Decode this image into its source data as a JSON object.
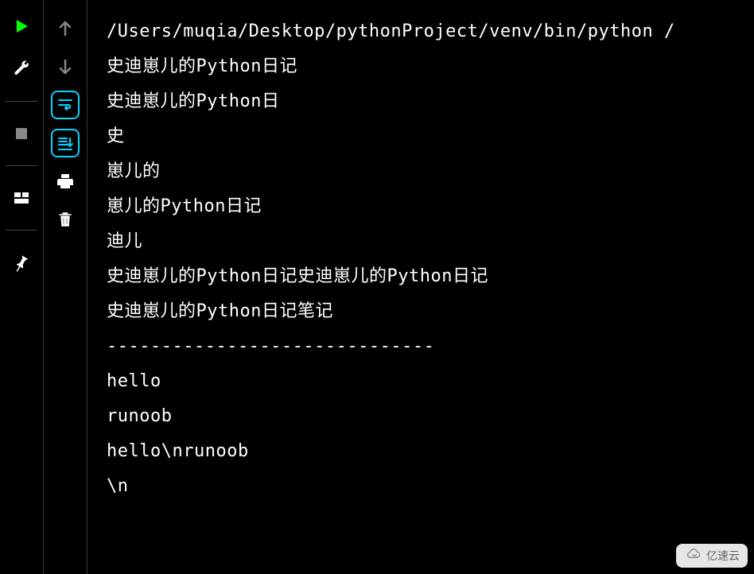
{
  "toolbar_left": {
    "run": "run-icon",
    "debug": "wrench-icon",
    "stop": "stop-icon",
    "layout": "layout-icon",
    "pin": "pin-icon"
  },
  "toolbar_actions": {
    "up": "arrow-up-icon",
    "down": "arrow-down-icon",
    "soft_wrap": "soft-wrap-icon",
    "scroll_end": "scroll-to-end-icon",
    "print": "print-icon",
    "clear": "trash-icon"
  },
  "console": {
    "lines": [
      "/Users/muqia/Desktop/pythonProject/venv/bin/python /",
      "史迪崽儿的Python日记",
      "史迪崽儿的Python日",
      "史",
      "崽儿的",
      "崽儿的Python日记",
      "迪儿",
      "史迪崽儿的Python日记史迪崽儿的Python日记",
      "史迪崽儿的Python日记笔记",
      "------------------------------",
      "hello",
      "runoob",
      "hello\\nrunoob",
      "",
      "",
      "\\n"
    ]
  },
  "watermark": {
    "text": "亿速云"
  }
}
